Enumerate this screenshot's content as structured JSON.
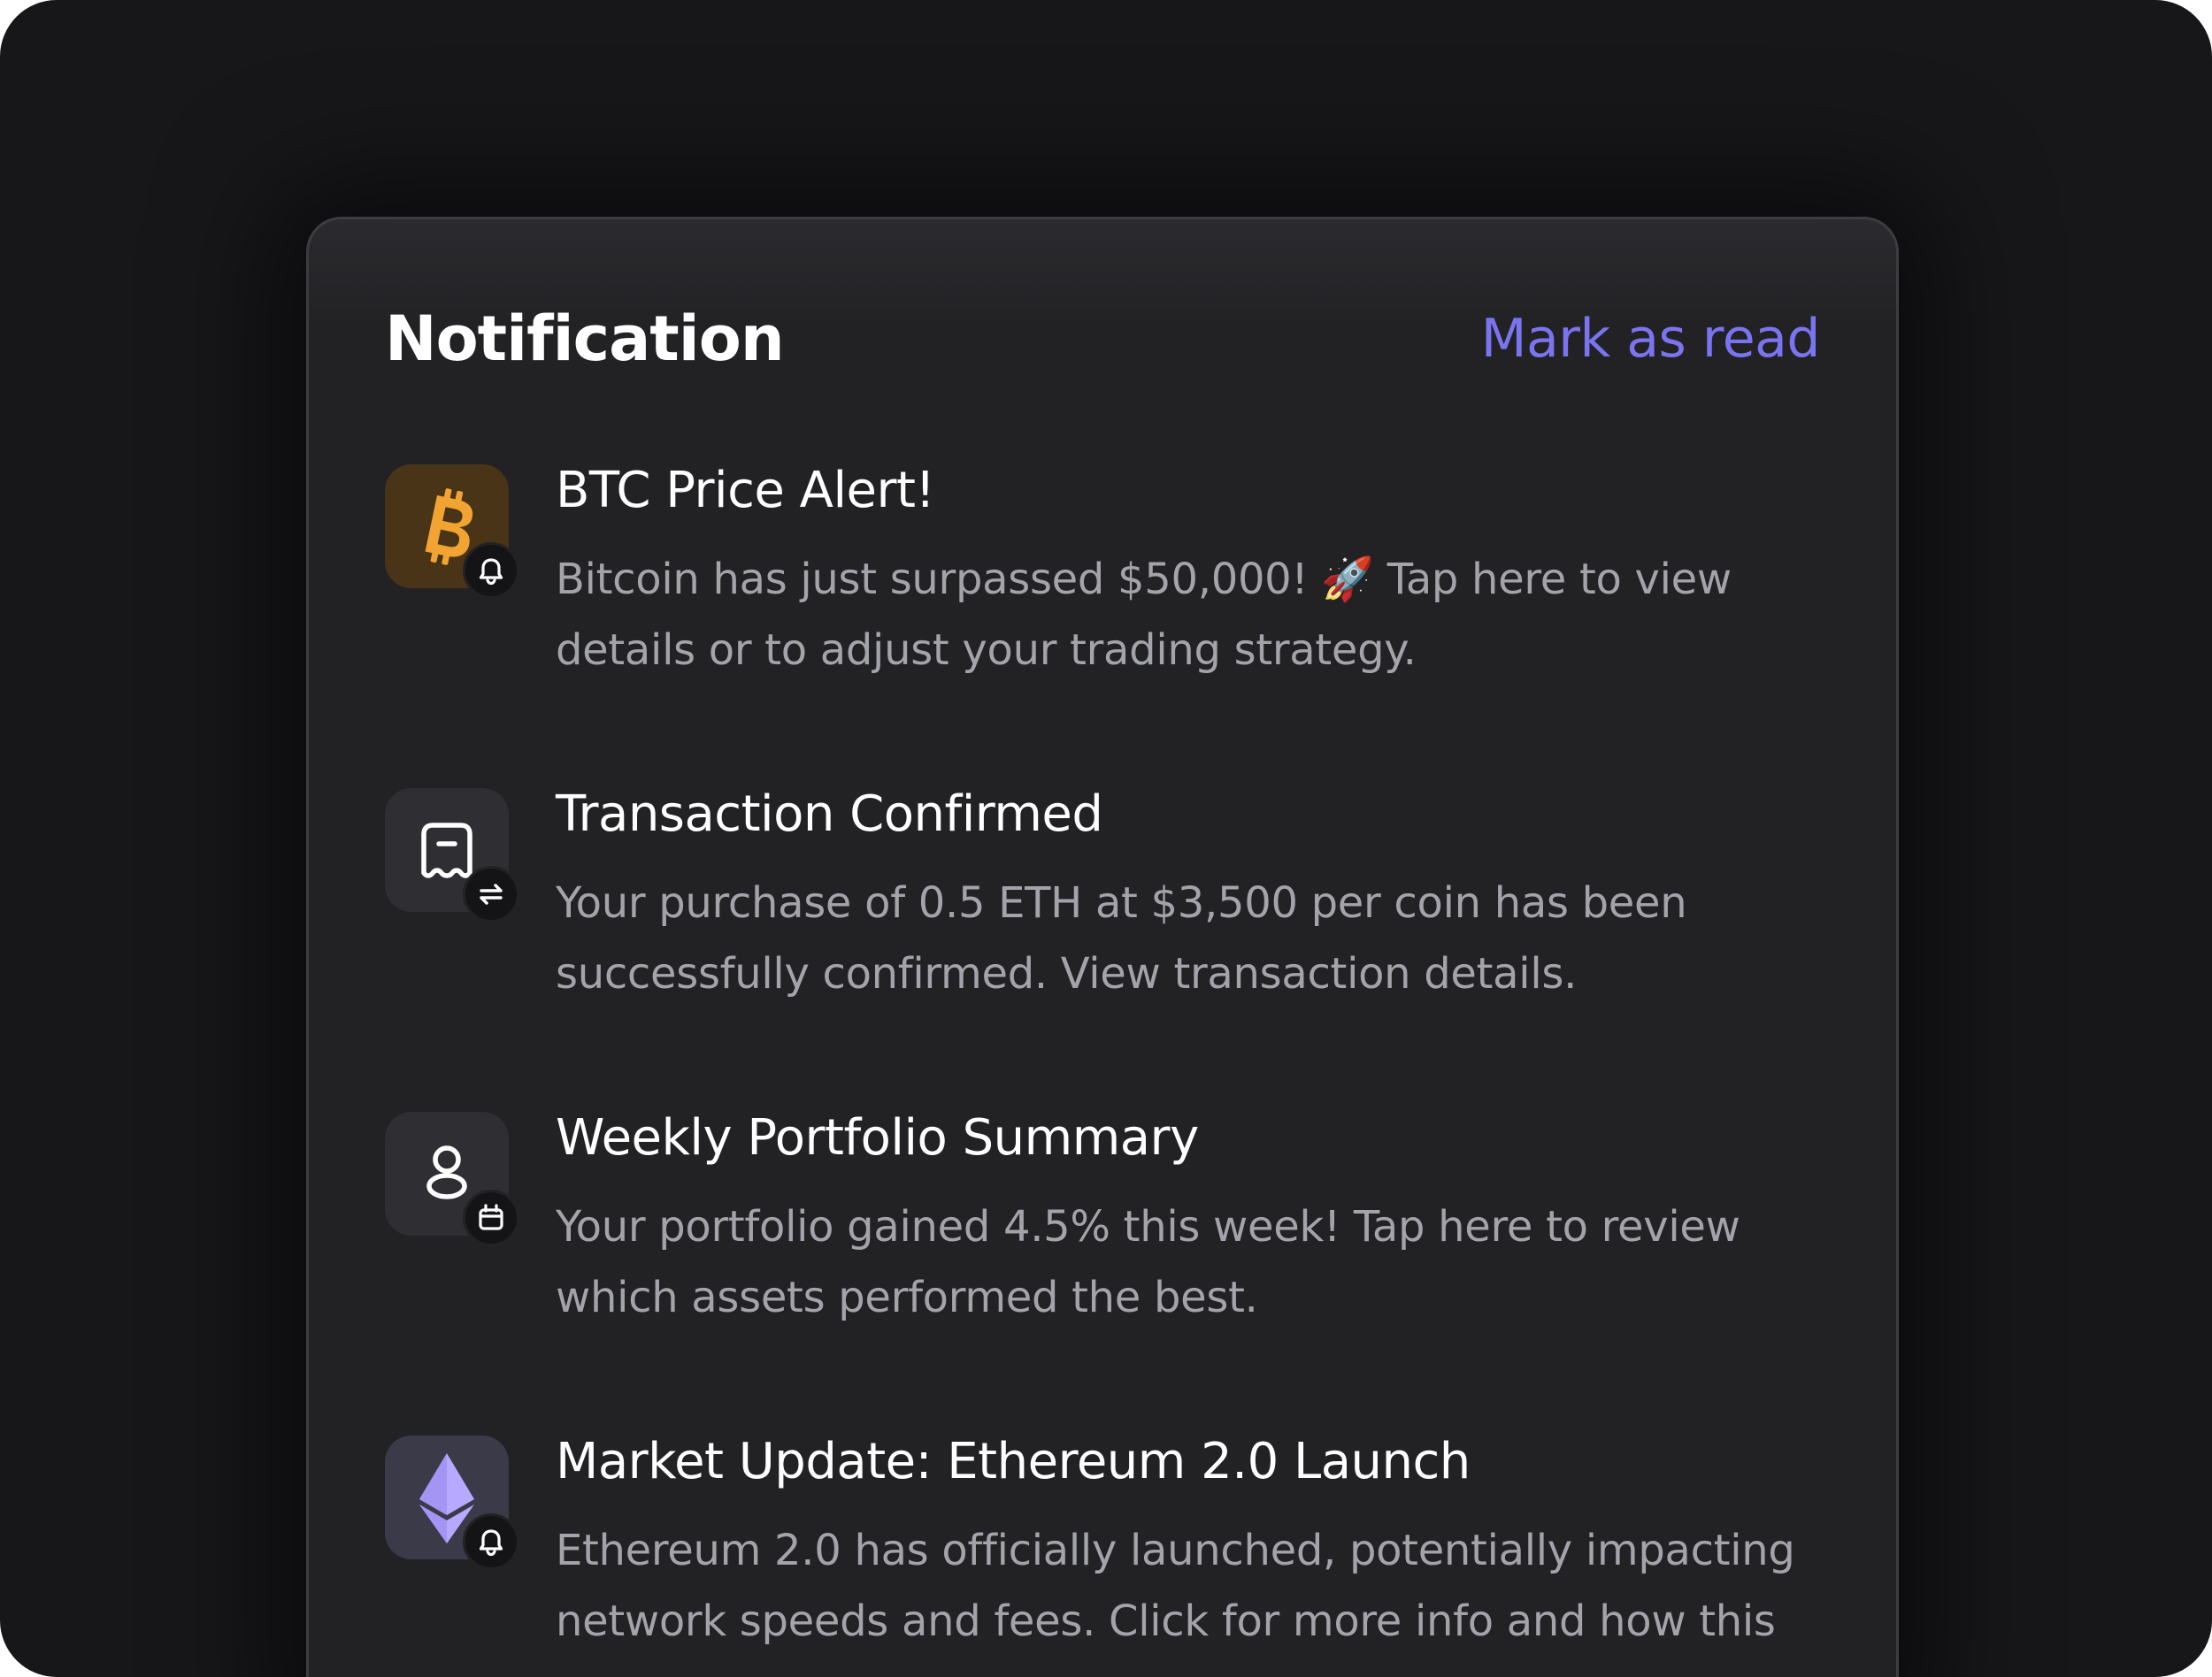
{
  "panel": {
    "title": "Notification",
    "mark_read_label": "Mark as read"
  },
  "notifications": [
    {
      "icon": "bitcoin-icon",
      "badge_icon": "bell-icon",
      "title": "BTC Price Alert!",
      "body": "Bitcoin has just surpassed $50,000! 🚀 Tap here to view details or to adjust your trading strategy."
    },
    {
      "icon": "receipt-icon",
      "badge_icon": "swap-arrows-icon",
      "title": "Transaction Confirmed",
      "body": "Your purchase of 0.5 ETH at $3,500 per coin has been successfully confirmed. View transaction details."
    },
    {
      "icon": "portfolio-icon",
      "badge_icon": "calendar-icon",
      "title": "Weekly Portfolio Summary",
      "body": "Your portfolio gained 4.5% this week! Tap here to review which assets performed the best."
    },
    {
      "icon": "ethereum-icon",
      "badge_icon": "bell-icon",
      "title": "Market Update: Ethereum 2.0 Launch",
      "body": "Ethereum 2.0 has officially launched, potentially impacting network speeds and fees. Click for more info and how this"
    }
  ],
  "colors": {
    "background": "#17171a",
    "panel": "#222225",
    "accent": "#7b74f0",
    "bitcoin": "#f2a432",
    "ethereum": "#b7a9ff"
  }
}
